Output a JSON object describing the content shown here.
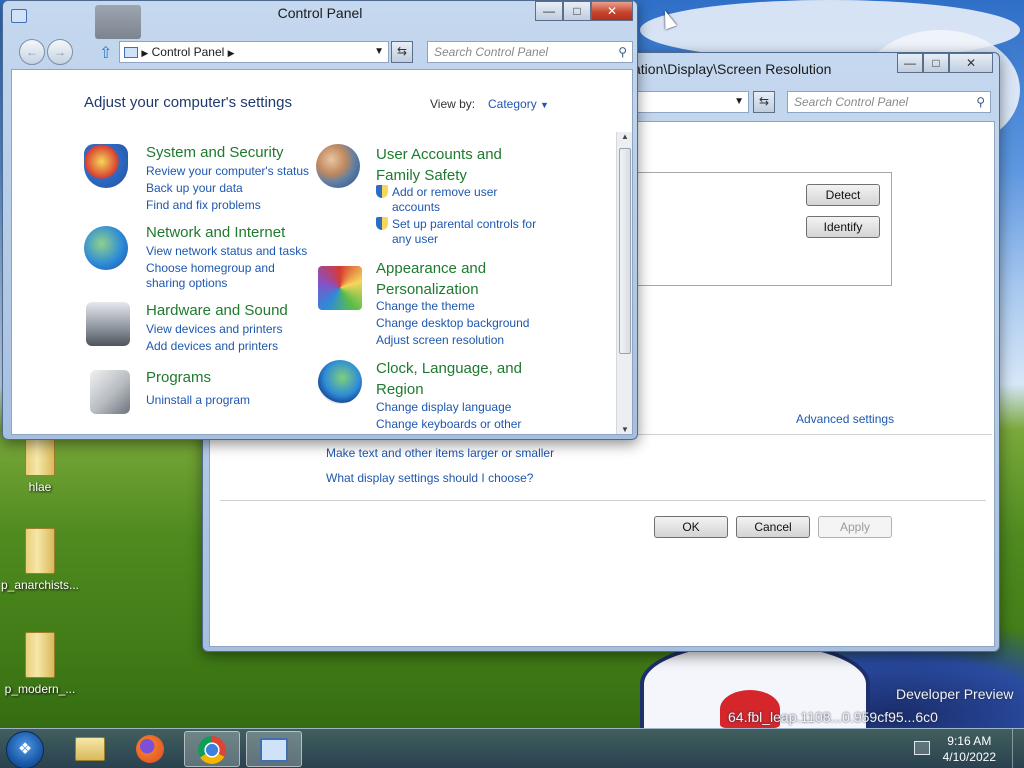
{
  "desktop": {
    "icons": [
      {
        "label": "hlae"
      },
      {
        "label": "p_anarchists..."
      },
      {
        "label": "p_modern_..."
      }
    ],
    "watermark_line1": "Developer Preview",
    "watermark_line2": "64.fbl_leap.1108...0.959cf95...6c0"
  },
  "taskbar": {
    "start_label": "Start",
    "clock_time": "9:16 AM",
    "clock_date": "4/10/2022",
    "buttons": [
      "Windows Explorer",
      "Firefox",
      "Chrome",
      "Control Panel"
    ]
  },
  "screen_res_window": {
    "address": "ation\\Display\\Screen Resolution",
    "search_placeholder": "Search Control Panel",
    "detect_label": "Detect",
    "identify_label": "Identify",
    "advanced_label": "Advanced settings",
    "link_text_size": "Make text and other items larger or smaller",
    "link_help": "What display settings should I choose?",
    "ok_label": "OK",
    "cancel_label": "Cancel",
    "apply_label": "Apply"
  },
  "control_panel": {
    "title": "Control Panel",
    "breadcrumb": "Control Panel",
    "search_placeholder": "Search Control Panel",
    "heading": "Adjust your computer's settings",
    "view_by_label": "View by:",
    "view_by_value": "Category",
    "categories_left": [
      {
        "title": "System and Security",
        "links": [
          "Review your computer's status",
          "Back up your data",
          "Find and fix problems"
        ]
      },
      {
        "title": "Network and Internet",
        "links": [
          "View network status and tasks",
          "Choose homegroup and",
          "sharing options"
        ]
      },
      {
        "title": "Hardware and Sound",
        "links": [
          "View devices and printers",
          "Add devices and printers"
        ]
      },
      {
        "title": "Programs",
        "links": [
          "Uninstall a program"
        ]
      }
    ],
    "categories_right": [
      {
        "title_line1": "User Accounts and",
        "title_line2": "Family Safety",
        "links": [
          "Add or remove user",
          "accounts",
          "Set up parental controls for",
          "any user"
        ]
      },
      {
        "title_line1": "Appearance and",
        "title_line2": "Personalization",
        "links": [
          "Change the theme",
          "Change desktop background",
          "Adjust screen resolution"
        ]
      },
      {
        "title_line1": "Clock, Language, and",
        "title_line2": "Region",
        "links": [
          "Change display language",
          "Change keyboards or other"
        ]
      }
    ]
  },
  "colors": {
    "link": "#1e58b0",
    "category_title": "#1e7a2e",
    "heading": "#1e3a6e"
  }
}
